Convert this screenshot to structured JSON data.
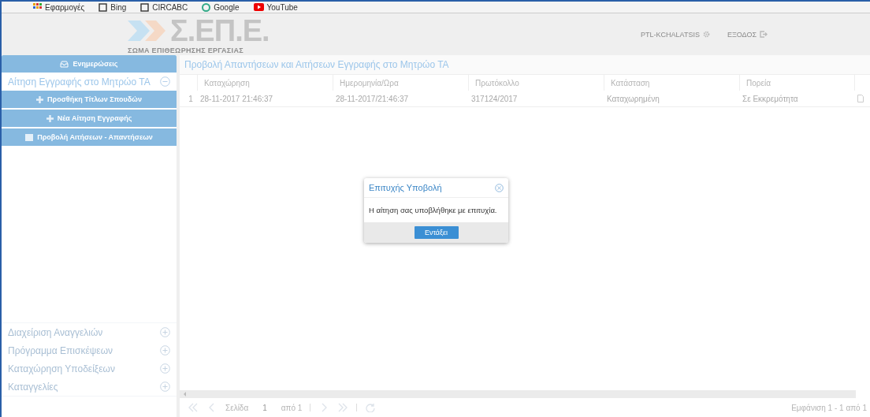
{
  "bookmarks": [
    {
      "label": "Εφαρμογές",
      "kind": "apps"
    },
    {
      "label": "Bing",
      "kind": "square"
    },
    {
      "label": "CIRCABC",
      "kind": "square"
    },
    {
      "label": "Google",
      "kind": "circle"
    },
    {
      "label": "YouTube",
      "kind": "play"
    }
  ],
  "header": {
    "logo_title": "Σ.ΕΠ.Ε.",
    "logo_subtitle": "ΣΩΜΑ ΕΠΙΘΕΩΡΗΣΗΣ ΕΡΓΑΣΙΑΣ",
    "user": "PTL-KCHALATSIS",
    "logout": "ΕΞΟΔΟΣ"
  },
  "sidebar": {
    "top_button": "Ενημερώσεις",
    "sections": [
      {
        "label": "Αίτηση Εγγραφής στο Μητρώο ΤΑ",
        "expanded": true,
        "children": [
          {
            "label": "Προσθήκη Τίτλων Σπουδών",
            "kind": "add"
          },
          {
            "label": "Νέα Αίτηση Εγγραφής",
            "kind": "add"
          },
          {
            "label": "Προβολή Αιτήσεων - Απαντήσεων",
            "kind": "view"
          }
        ]
      },
      {
        "label": "Διαχείριση Αναγγελιών",
        "expanded": false
      },
      {
        "label": "Πρόγραμμα Επισκέψεων",
        "expanded": false
      },
      {
        "label": "Καταχώρηση Υποδείξεων",
        "expanded": false
      },
      {
        "label": "Καταγγελίες",
        "expanded": false
      }
    ]
  },
  "content": {
    "title": "Προβολή Απαντήσεων και Αιτήσεων Εγγραφής στο Μητρώο ΤΑ",
    "table": {
      "columns": [
        "Καταχώρηση",
        "Ημερομηνία/Ωρα",
        "Πρωτόκολλο",
        "Κατάσταση",
        "Πορεία"
      ],
      "rows": [
        {
          "index": "1",
          "cells": [
            "28-11-2017 21:46:37",
            "28-11-2017/21:46:37",
            "317124/2017",
            "Καταχωρημένη",
            "Σε Εκκρεμότητα"
          ]
        }
      ]
    },
    "pager": {
      "page_label": "Σελίδα",
      "page": "1",
      "of": "από 1",
      "summary": "Εμφάνιση 1 - 1 από 1"
    }
  },
  "dialog": {
    "title": "Επιτυχής Υποβολή",
    "message": "Η αίτηση σας υποβλήθηκε με επιτυχία.",
    "button": "Εντάξει"
  }
}
